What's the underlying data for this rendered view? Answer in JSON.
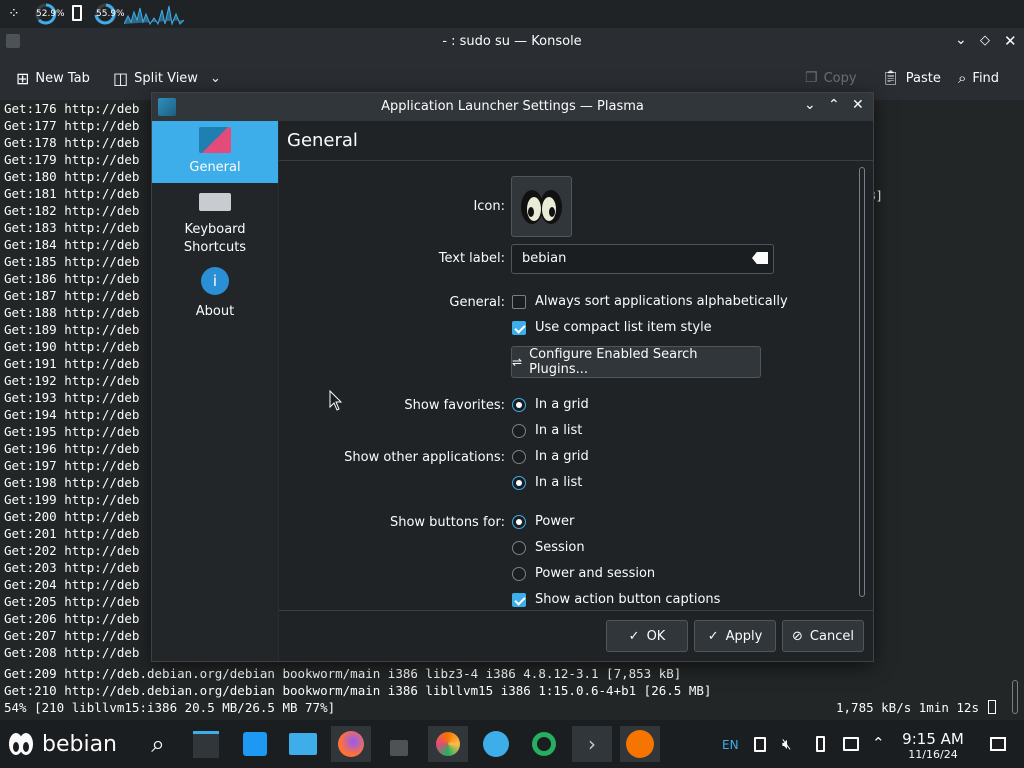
{
  "top_panel": {
    "cpu_pct": "52.9%",
    "mem_pct": "55.9%"
  },
  "konsole": {
    "title": "- : sudo su — Konsole",
    "toolbar": {
      "new_tab": "New Tab",
      "split_view": "Split View",
      "copy": "Copy",
      "paste": "Paste",
      "find": "Find"
    },
    "lines": [
      "Get:176 http://deb",
      "Get:177 http://deb",
      "Get:178 http://deb",
      "Get:179 http://deb",
      "Get:180 http://deb",
      "Get:181 http://deb",
      "Get:182 http://deb",
      "Get:183 http://deb",
      "Get:184 http://deb",
      "Get:185 http://deb",
      "Get:186 http://deb",
      "Get:187 http://deb",
      "Get:188 http://deb",
      "Get:189 http://deb",
      "Get:190 http://deb",
      "Get:191 http://deb",
      "Get:192 http://deb",
      "Get:193 http://deb",
      "Get:194 http://deb",
      "Get:195 http://deb",
      "Get:196 http://deb",
      "Get:197 http://deb",
      "Get:198 http://deb",
      "Get:199 http://deb",
      "Get:200 http://deb",
      "Get:201 http://deb",
      "Get:202 http://deb",
      "Get:203 http://deb",
      "Get:204 http://deb",
      "Get:205 http://deb",
      "Get:206 http://deb",
      "Get:207 http://deb",
      "Get:208 http://deb"
    ],
    "right_fragment": "B]",
    "full_lines": [
      "Get:209 http://deb.debian.org/debian bookworm/main i386 libz3-4 i386 4.8.12-3.1 [7,853 kB]",
      "Get:210 http://deb.debian.org/debian bookworm/main i386 libllvm15 i386 1:15.0.6-4+b1 [26.5 MB]"
    ],
    "progress_left": "54% [210 libllvm15:i386 20.5 MB/26.5 MB 77%]",
    "progress_right": "1,785 kB/s 1min 12s"
  },
  "dialog": {
    "title": "Application Launcher Settings — Plasma",
    "sidebar": [
      {
        "label": "General"
      },
      {
        "label": "Keyboard\nShortcuts"
      },
      {
        "label": "About"
      }
    ],
    "page_title": "General",
    "icon_label": "Icon:",
    "text_label_label": "Text label:",
    "text_label_value": "bebian",
    "general_label": "General:",
    "sort_alpha": "Always sort applications alphabetically",
    "compact_list": "Use compact list item style",
    "configure_plugins": "Configure Enabled Search Plugins...",
    "show_favorites_label": "Show favorites:",
    "show_other_label": "Show other applications:",
    "in_a_grid": "In a grid",
    "in_a_list": "In a list",
    "show_buttons_label": "Show buttons for:",
    "power": "Power",
    "session": "Session",
    "power_and_session": "Power and session",
    "show_captions": "Show action button captions",
    "ok": "OK",
    "apply": "Apply",
    "cancel": "Cancel"
  },
  "taskbar": {
    "launcher_label": "bebian",
    "lang": "EN",
    "clock_time": "9:15 AM",
    "clock_date": "11/16/24"
  },
  "colors": {
    "accent": "#3daee9",
    "bg": "#202326"
  }
}
